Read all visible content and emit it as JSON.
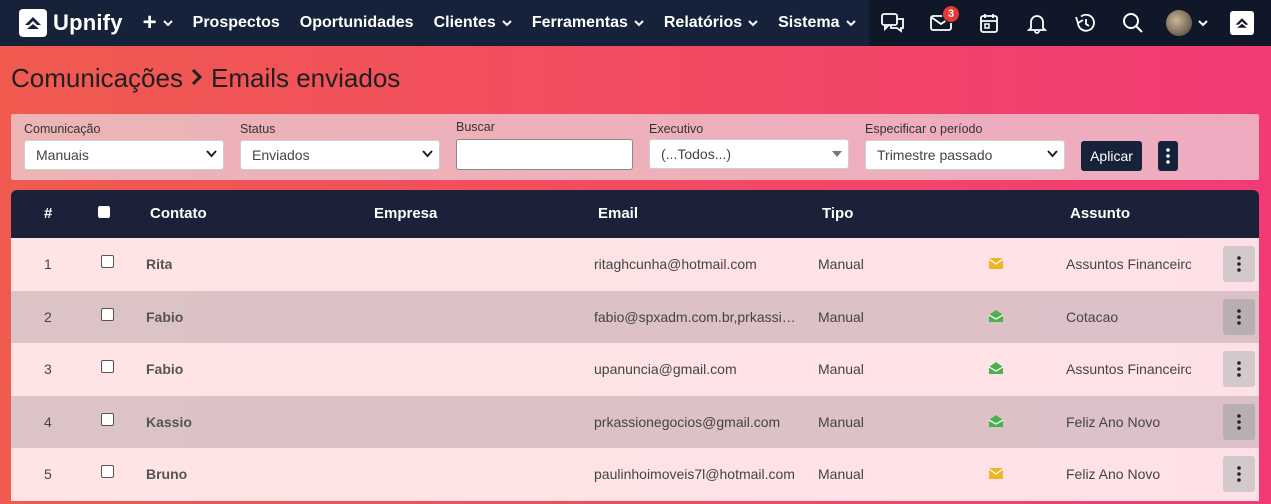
{
  "brand": {
    "name": "Upnify"
  },
  "nav": {
    "items": [
      {
        "label": "Prospectos",
        "dropdown": false
      },
      {
        "label": "Oportunidades",
        "dropdown": false
      },
      {
        "label": "Clientes",
        "dropdown": true
      },
      {
        "label": "Ferramentas",
        "dropdown": true
      },
      {
        "label": "Relatórios",
        "dropdown": true
      },
      {
        "label": "Sistema",
        "dropdown": true
      }
    ],
    "mail_badge": "3",
    "icons": [
      "chat-icon",
      "mail-icon",
      "calendar-icon",
      "bell-icon",
      "history-icon",
      "search-icon",
      "avatar",
      "upnify-app-icon"
    ]
  },
  "page": {
    "breadcrumb_parent": "Comunicações",
    "breadcrumb_current": "Emails enviados"
  },
  "filters": {
    "comunicacao": {
      "label": "Comunicação",
      "value": "Manuais"
    },
    "status": {
      "label": "Status",
      "value": "Enviados"
    },
    "buscar": {
      "label": "Buscar",
      "value": ""
    },
    "executivo": {
      "label": "Executivo",
      "value": "(...Todos...)"
    },
    "periodo": {
      "label": "Especificar o período",
      "value": "Trimestre passado"
    },
    "apply_label": "Aplicar"
  },
  "table": {
    "headers": {
      "num": "#",
      "contato": "Contato",
      "empresa": "Empresa",
      "email": "Email",
      "tipo": "Tipo",
      "assunto": "Assunto"
    },
    "rows": [
      {
        "num": "1",
        "contato": "Rita",
        "empresa": "",
        "email": "ritaghcunha@hotmail.com",
        "tipo": "Manual",
        "status_icon": "envelope-closed",
        "assunto": "Assuntos Financeiros"
      },
      {
        "num": "2",
        "contato": "Fabio",
        "empresa": "",
        "email": "fabio@spxadm.com.br,prkassi…",
        "tipo": "Manual",
        "status_icon": "envelope-open",
        "assunto": "Cotacao"
      },
      {
        "num": "3",
        "contato": "Fabio",
        "empresa": "",
        "email": "upanuncia@gmail.com",
        "tipo": "Manual",
        "status_icon": "envelope-open",
        "assunto": "Assuntos Financeiros"
      },
      {
        "num": "4",
        "contato": "Kassio",
        "empresa": "",
        "email": "prkassionegocios@gmail.com",
        "tipo": "Manual",
        "status_icon": "envelope-open",
        "assunto": "Feliz Ano Novo"
      },
      {
        "num": "5",
        "contato": "Bruno",
        "empresa": "",
        "email": "paulinhoimoveis7l@hotmail.com",
        "tipo": "Manual",
        "status_icon": "envelope-closed",
        "assunto": "Feliz Ano Novo"
      }
    ]
  },
  "colors": {
    "navbar": "#16213a",
    "accent_red": "#e53935",
    "closed_envelope": "#f0b429",
    "open_envelope": "#4caf50"
  }
}
